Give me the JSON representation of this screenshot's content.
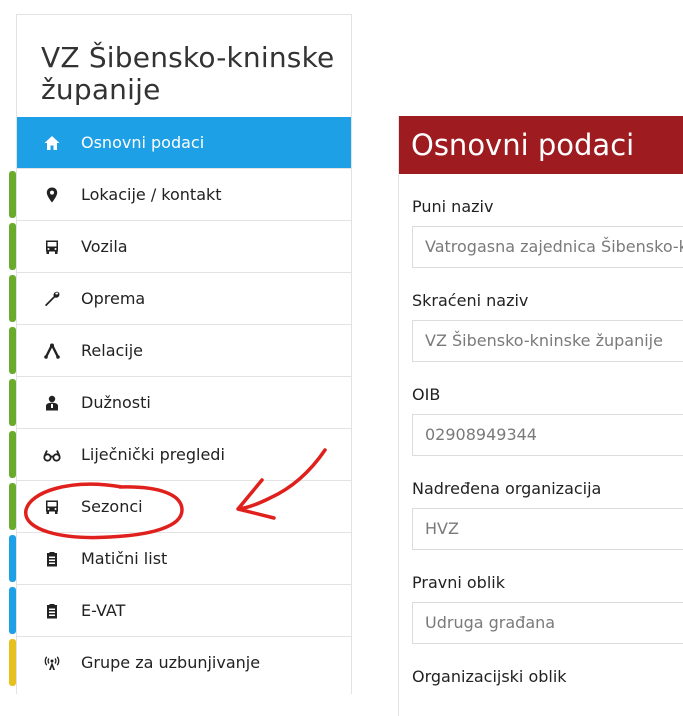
{
  "sidebar": {
    "title": "VZ Šibensko-kninske županije",
    "items": [
      {
        "label": "Osnovni podaci",
        "icon": "home-icon",
        "active": true,
        "bar": ""
      },
      {
        "label": "Lokacije / kontakt",
        "icon": "map-marker-icon",
        "bar": "#6aab2e"
      },
      {
        "label": "Vozila",
        "icon": "bus-icon",
        "bar": "#6aab2e"
      },
      {
        "label": "Oprema",
        "icon": "wrench-icon",
        "bar": "#6aab2e"
      },
      {
        "label": "Relacije",
        "icon": "relations-icon",
        "bar": "#6aab2e"
      },
      {
        "label": "Dužnosti",
        "icon": "user-badge-icon",
        "bar": "#6aab2e"
      },
      {
        "label": "Liječnički pregledi",
        "icon": "glasses-icon",
        "bar": "#6aab2e"
      },
      {
        "label": "Sezonci",
        "icon": "bus-icon",
        "bar": "#6aab2e"
      },
      {
        "label": "Matični list",
        "icon": "clipboard-icon",
        "bar": "#1ea0e6"
      },
      {
        "label": "E-VAT",
        "icon": "clipboard-icon",
        "bar": "#1ea0e6"
      },
      {
        "label": "Grupe za uzbunjivanje",
        "icon": "broadcast-icon",
        "bar": "#e6c01e"
      }
    ]
  },
  "panel": {
    "title": "Osnovni podaci",
    "fields": [
      {
        "label": "Puni naziv",
        "value": "Vatrogasna zajednica Šibensko-kninske županije"
      },
      {
        "label": "Skraćeni naziv",
        "value": "VZ Šibensko-kninske županije"
      },
      {
        "label": "OIB",
        "value": "02908949344"
      },
      {
        "label": "Nadređena organizacija",
        "value": "HVZ"
      },
      {
        "label": "Pravni oblik",
        "value": "Udruga građana"
      }
    ],
    "next_label": "Organizacijski oblik"
  },
  "colors": {
    "active": "#1ea0e6",
    "header": "#9e1b1f",
    "annotation": "#e0201c"
  }
}
